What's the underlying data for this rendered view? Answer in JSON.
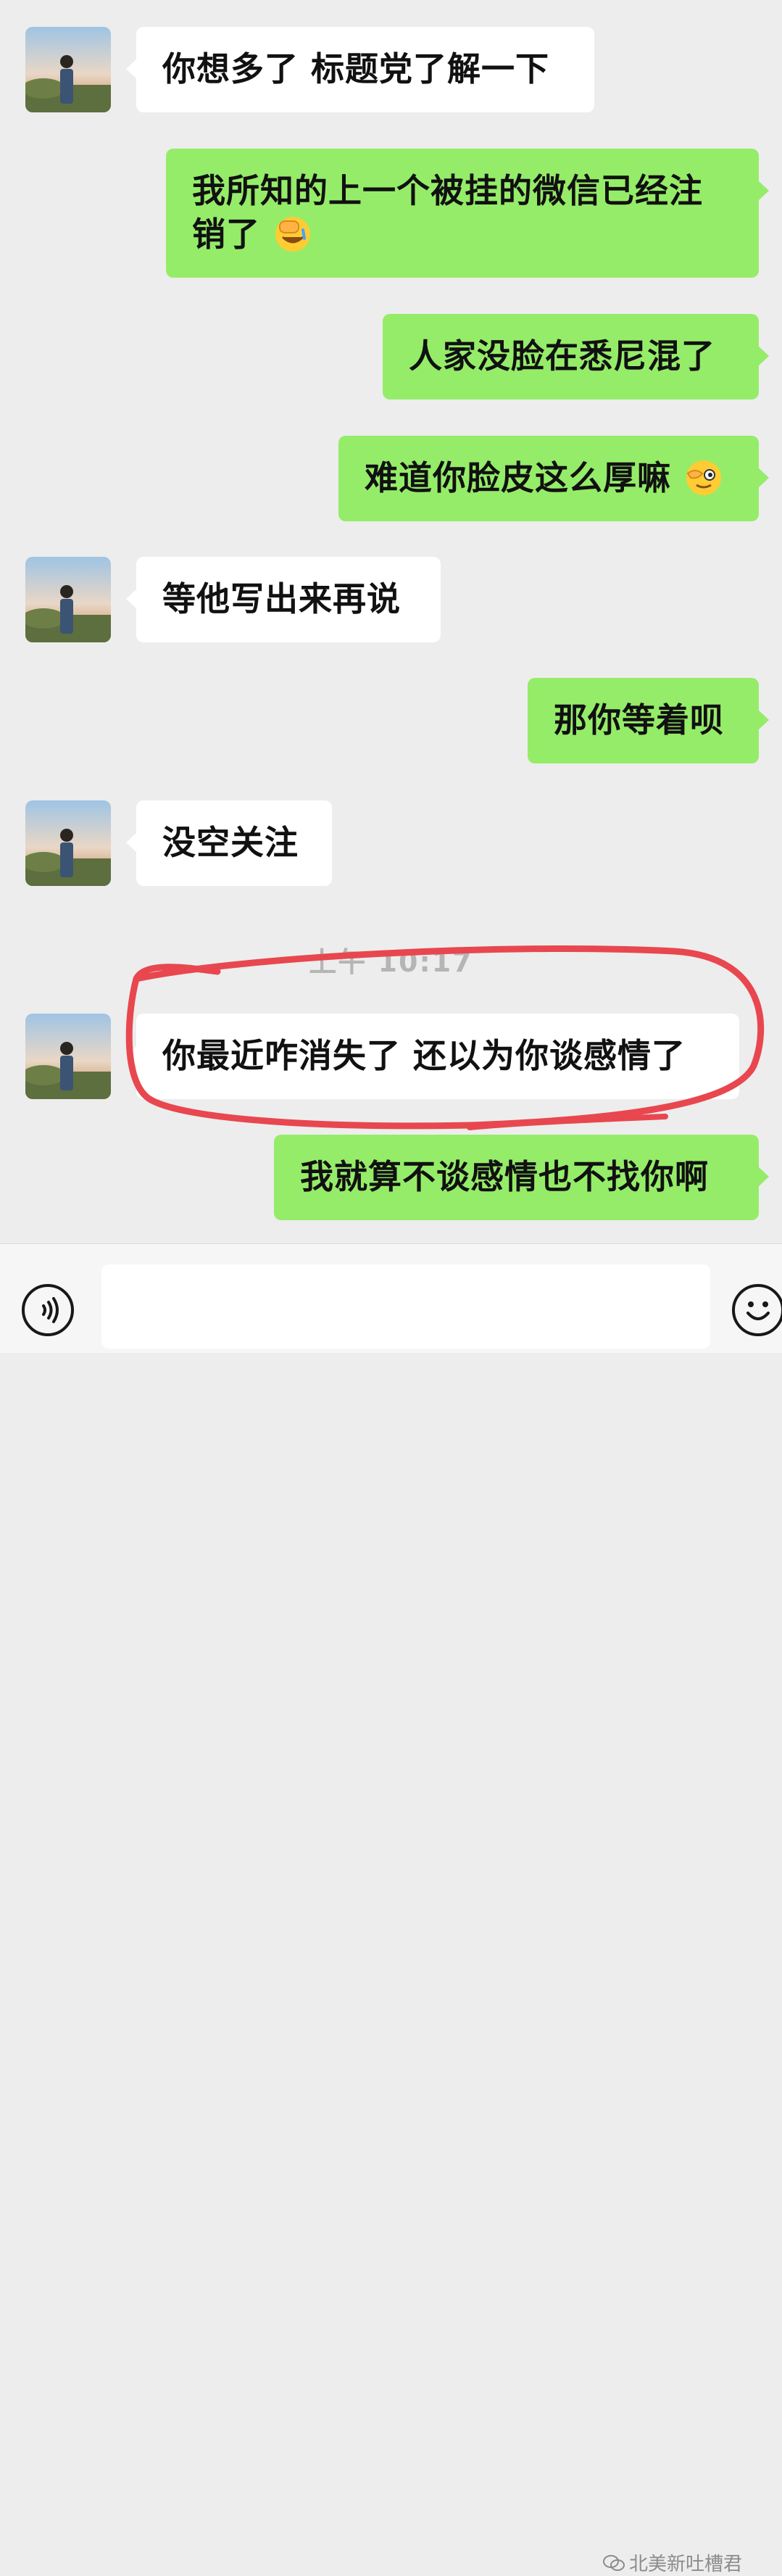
{
  "messages": [
    {
      "side": "in",
      "text": "你想多了 标题党了解一下"
    },
    {
      "side": "out",
      "text": "我所知的上一个被挂的微信已经注销了"
    },
    {
      "side": "out",
      "text": "人家没脸在悉尼混了"
    },
    {
      "side": "out",
      "text": "难道你脸皮这么厚嘛"
    },
    {
      "side": "in",
      "text": "等他写出来再说"
    },
    {
      "side": "out",
      "text": "那你等着呗"
    },
    {
      "side": "in",
      "text": "没空关注"
    },
    {
      "side": "in",
      "text": "你最近咋消失了 还以为你谈感情了"
    },
    {
      "side": "out",
      "text": "我就算不谈感情也不找你啊"
    }
  ],
  "emojis": {
    "msg2": "facepalm-crying-emoji",
    "msg4": "wink-hand-emoji"
  },
  "timestamp": "上午 10:17",
  "input_bar": {
    "voice_icon": "voice-icon",
    "input_value": "",
    "emoji_icon": "smiley-icon"
  },
  "watermark": "北美新吐槽君",
  "colors": {
    "background": "#ededed",
    "incoming_bubble": "#ffffff",
    "outgoing_bubble": "#95ec69",
    "highlight_circle": "#e8474f"
  }
}
